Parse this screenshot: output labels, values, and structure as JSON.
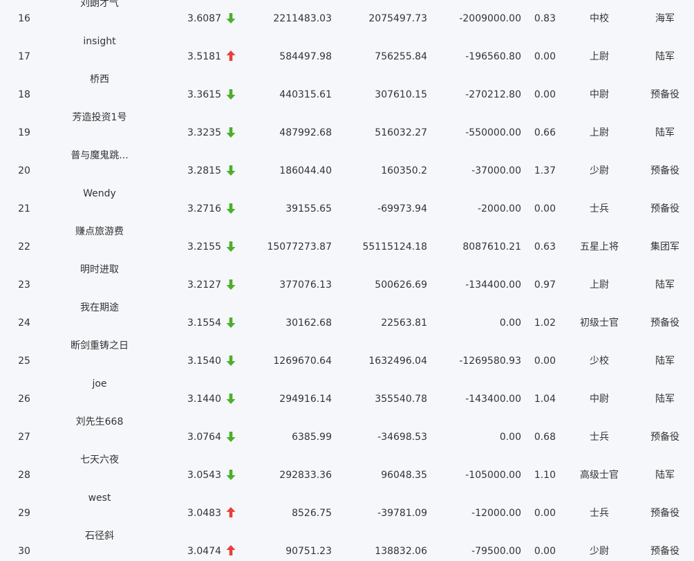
{
  "colors": {
    "up": "#e8403a",
    "down": "#4caf2a"
  },
  "rows": [
    {
      "rank": "16",
      "name": "刘朗才气",
      "score": "3.6087",
      "trend": "down",
      "c1": "2211483.03",
      "c2": "2075497.73",
      "c3": "-2009000.00",
      "c4": "0.83",
      "title": "中校",
      "branch": "海军"
    },
    {
      "rank": "17",
      "name": "insight",
      "score": "3.5181",
      "trend": "up",
      "c1": "584497.98",
      "c2": "756255.84",
      "c3": "-196560.80",
      "c4": "0.00",
      "title": "上尉",
      "branch": "陆军"
    },
    {
      "rank": "18",
      "name": "桥西",
      "score": "3.3615",
      "trend": "down",
      "c1": "440315.61",
      "c2": "307610.15",
      "c3": "-270212.80",
      "c4": "0.00",
      "title": "中尉",
      "branch": "预备役"
    },
    {
      "rank": "19",
      "name": "芳造投资1号",
      "score": "3.3235",
      "trend": "down",
      "c1": "487992.68",
      "c2": "516032.27",
      "c3": "-550000.00",
      "c4": "0.66",
      "title": "上尉",
      "branch": "陆军"
    },
    {
      "rank": "20",
      "name": "普与魔鬼跳...",
      "score": "3.2815",
      "trend": "down",
      "c1": "186044.40",
      "c2": "160350.2",
      "c3": "-37000.00",
      "c4": "1.37",
      "title": "少尉",
      "branch": "预备役"
    },
    {
      "rank": "21",
      "name": "Wendy",
      "score": "3.2716",
      "trend": "down",
      "c1": "39155.65",
      "c2": "-69973.94",
      "c3": "-2000.00",
      "c4": "0.00",
      "title": "士兵",
      "branch": "预备役"
    },
    {
      "rank": "22",
      "name": "赚点旅游费",
      "score": "3.2155",
      "trend": "down",
      "c1": "15077273.87",
      "c2": "55115124.18",
      "c3": "8087610.21",
      "c4": "0.63",
      "title": "五星上将",
      "branch": "集团军"
    },
    {
      "rank": "23",
      "name": "明时进取",
      "score": "3.2127",
      "trend": "down",
      "c1": "377076.13",
      "c2": "500626.69",
      "c3": "-134400.00",
      "c4": "0.97",
      "title": "上尉",
      "branch": "陆军"
    },
    {
      "rank": "24",
      "name": "我在期途",
      "score": "3.1554",
      "trend": "down",
      "c1": "30162.68",
      "c2": "22563.81",
      "c3": "0.00",
      "c4": "1.02",
      "title": "初级士官",
      "branch": "预备役"
    },
    {
      "rank": "25",
      "name": "断剑重铸之日",
      "score": "3.1540",
      "trend": "down",
      "c1": "1269670.64",
      "c2": "1632496.04",
      "c3": "-1269580.93",
      "c4": "0.00",
      "title": "少校",
      "branch": "陆军"
    },
    {
      "rank": "26",
      "name": "joe",
      "score": "3.1440",
      "trend": "down",
      "c1": "294916.14",
      "c2": "355540.78",
      "c3": "-143400.00",
      "c4": "1.04",
      "title": "中尉",
      "branch": "陆军"
    },
    {
      "rank": "27",
      "name": "刘先生668",
      "score": "3.0764",
      "trend": "down",
      "c1": "6385.99",
      "c2": "-34698.53",
      "c3": "0.00",
      "c4": "0.68",
      "title": "士兵",
      "branch": "预备役"
    },
    {
      "rank": "28",
      "name": "七天六夜",
      "score": "3.0543",
      "trend": "down",
      "c1": "292833.36",
      "c2": "96048.35",
      "c3": "-105000.00",
      "c4": "1.10",
      "title": "高级士官",
      "branch": "陆军"
    },
    {
      "rank": "29",
      "name": "west",
      "score": "3.0483",
      "trend": "up",
      "c1": "8526.75",
      "c2": "-39781.09",
      "c3": "-12000.00",
      "c4": "0.00",
      "title": "士兵",
      "branch": "预备役"
    },
    {
      "rank": "30",
      "name": "石径斜",
      "score": "3.0474",
      "trend": "up",
      "c1": "90751.23",
      "c2": "138832.06",
      "c3": "-79500.00",
      "c4": "0.00",
      "title": "少尉",
      "branch": "预备役"
    }
  ]
}
